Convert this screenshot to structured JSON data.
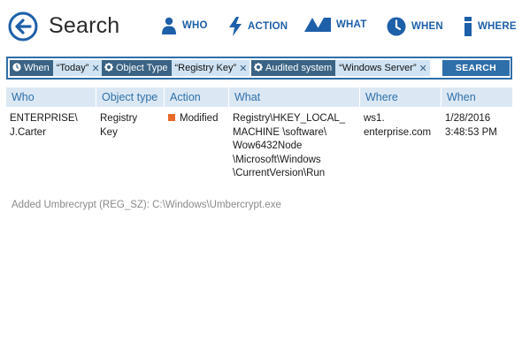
{
  "header": {
    "title": "Search",
    "nav": [
      {
        "label": "WHO",
        "icon": "person-icon"
      },
      {
        "label": "ACTION",
        "icon": "lightning-icon"
      },
      {
        "label": "WHAT",
        "icon": "what-triangle-icon"
      },
      {
        "label": "WHEN",
        "icon": "clock-icon"
      },
      {
        "label": "WHERE",
        "icon": "where-pin-icon"
      }
    ]
  },
  "filters": [
    {
      "key": "When",
      "value": "“Today”",
      "icon": "clock-icon"
    },
    {
      "key": "Object Type",
      "value": "“Registry Key”",
      "icon": "gear-icon"
    },
    {
      "key": "Audited system",
      "value": "“Windows Server”",
      "icon": "gear-icon"
    }
  ],
  "search_button": "SEARCH",
  "table": {
    "columns": [
      "Who",
      "Object type",
      "Action",
      "What",
      "Where",
      "When"
    ],
    "rows": [
      {
        "who": "ENTERPRISE\\\nJ.Carter",
        "object_type": "Registry\nKey",
        "action": "Modified",
        "what": "Registry\\HKEY_LOCAL_\nMACHINE \\software\\\nWow6432Node\n\\Microsoft\\Windows\n\\CurrentVersion\\Run",
        "where": "ws1.\nenterprise.com",
        "when": "1/28/2016\n3:48:53 PM"
      }
    ]
  },
  "detail": "Added Umbrecrypt (REG_SZ): C:\\Windows\\Umbercrypt.exe",
  "colors": {
    "accent": "#1d5fa8",
    "chip_key": "#3a6384",
    "chip_value": "#cfe3f3",
    "header_row": "#dbe8f4",
    "action_modified": "#e8692a"
  }
}
